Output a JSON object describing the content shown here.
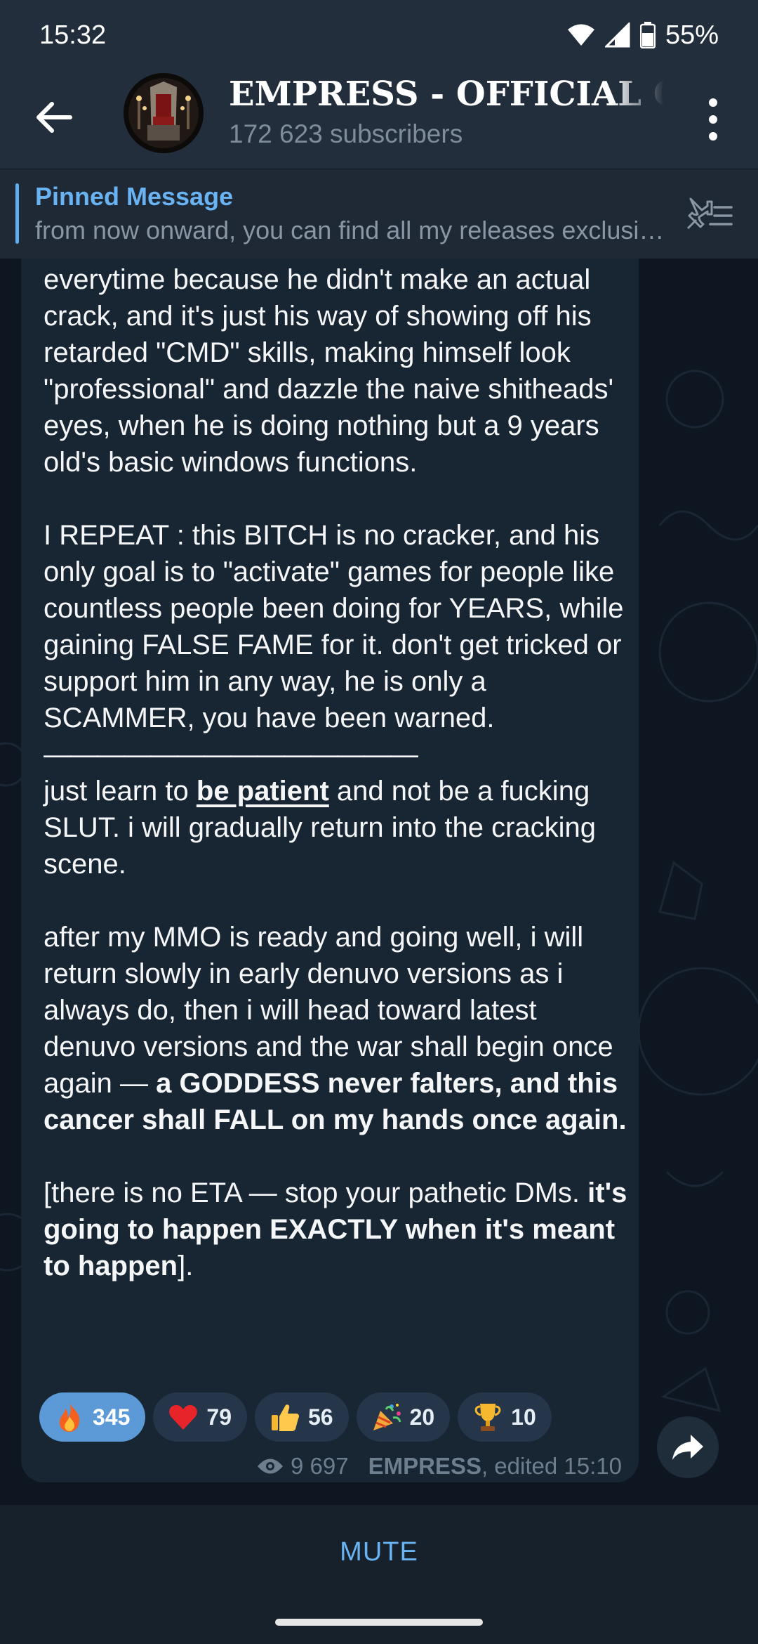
{
  "status_bar": {
    "time": "15:32",
    "battery": "55%"
  },
  "header": {
    "title": "EMPRESS - OFFICIAL CHANNEL",
    "subscribers": "172 623 subscribers"
  },
  "pinned": {
    "title": "Pinned Message",
    "text": "from now onward, you can find all my releases exclusively on"
  },
  "message": {
    "p1": "everytime because he didn't make an actual crack, and it's just his way of showing off his retarded \"CMD\" skills, making himself look \"professional\" and dazzle the naive shitheads' eyes, when he is doing nothing but a 9 years old's basic windows functions.",
    "p2": "I REPEAT : this BITCH is no cracker, and his only goal is to \"activate\" games for people like countless people been doing for YEARS, while gaining FALSE FAME for it. don't get tricked or support him in any way, he is only a SCAMMER, you have been warned.",
    "divider": "——————————————",
    "p3_a": "just learn to ",
    "p3_b": "be patient",
    "p3_c": " and not be a fucking SLUT. i will gradually return into the cracking scene.",
    "p4_a": "after my MMO is ready and going well, i will return slowly in early denuvo versions as i always do, then i will head toward latest denuvo versions and the war shall begin once again — ",
    "p4_b": "a GODDESS never falters, and this cancer shall FALL on my hands once again.",
    "p5_a": "[there is no ETA — stop your pathetic DMs. ",
    "p5_b": "it's going to happen EXACTLY when it's meant to happen",
    "p5_c": "]."
  },
  "reactions": [
    {
      "icon": "fire-icon",
      "count": "345"
    },
    {
      "icon": "heart-icon",
      "count": "79"
    },
    {
      "icon": "thumbs-up-icon",
      "count": "56"
    },
    {
      "icon": "party-popper-icon",
      "count": "20"
    },
    {
      "icon": "trophy-icon",
      "count": "10"
    }
  ],
  "meta": {
    "views": "9 697",
    "author": "EMPRESS",
    "edited": ", edited 15:10"
  },
  "bottom": {
    "mute_label": "MUTE"
  },
  "colors": {
    "accent": "#6ab3f3",
    "header_bg": "#232e3c",
    "chat_bg": "#0e1621",
    "bubble_bg": "#182533",
    "active_reaction": "#5b9ad6"
  }
}
